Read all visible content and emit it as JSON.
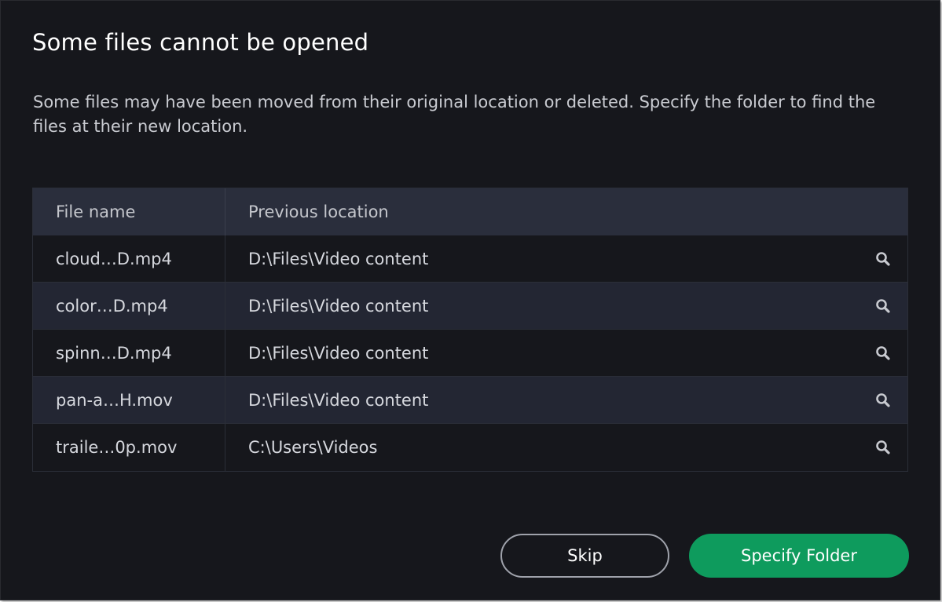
{
  "dialog": {
    "title": "Some files cannot be opened",
    "description": "Some files may have been moved from their original location or deleted. Specify the folder to find the files at their new location."
  },
  "table": {
    "headers": {
      "file_name": "File name",
      "previous_location": "Previous location"
    },
    "rows": [
      {
        "file_name": "cloud…D.mp4",
        "location": "D:\\Files\\Video content",
        "action_icon": "search-icon"
      },
      {
        "file_name": "color…D.mp4",
        "location": "D:\\Files\\Video content",
        "action_icon": "search-icon"
      },
      {
        "file_name": "spinn…D.mp4",
        "location": "D:\\Files\\Video content",
        "action_icon": "search-icon"
      },
      {
        "file_name": "pan-a…H.mov",
        "location": "D:\\Files\\Video content",
        "action_icon": "search-icon"
      },
      {
        "file_name": "traile…0p.mov",
        "location": "C:\\Users\\Videos",
        "action_icon": "search-icon"
      }
    ]
  },
  "buttons": {
    "skip_label": "Skip",
    "specify_folder_label": "Specify Folder"
  },
  "colors": {
    "background": "#16171c",
    "header_row": "#2a2e3c",
    "alt_row": "#232633",
    "accent_green": "#0e9b5d"
  }
}
